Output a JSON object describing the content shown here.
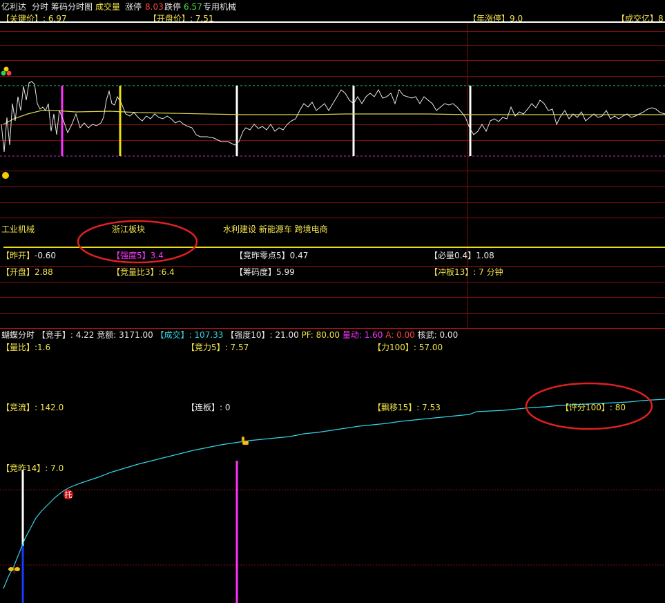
{
  "header": {
    "stock_name": "亿利达",
    "tab_intraday": "分时",
    "tab_chip": "筹码分时图",
    "volume_label": "成交量",
    "limit_up_label": "涨停",
    "limit_up_value": "8.03",
    "limit_down_label": "跌停",
    "limit_down_value": "6.57",
    "sector": "专用机械"
  },
  "price_bar": {
    "key_price": "【关键价】: 6.97",
    "open_price": "【开盘价】: 7.51",
    "year_limit_up": "【年涨停】9.0",
    "turnover": "【成交亿】8"
  },
  "concepts": {
    "industry": "工业机械",
    "board": "浙江板块",
    "themes": "水利建设 新能源车 跨境电商"
  },
  "stats_row1": {
    "prev_open": {
      "label": "【昨开】",
      "value": "-0.60"
    },
    "strength": {
      "label": "【强度5】",
      "value": "3.4"
    },
    "bid_zero": {
      "label": "【竞昨零点5】",
      "value": "0.47"
    },
    "must_volume": {
      "label": "【必量0.4】",
      "value": "1.08"
    }
  },
  "stats_row2": {
    "open_rise": {
      "label": "【开盘】",
      "value": "2.88"
    },
    "bid_ratio": {
      "label": "【竞量比3】",
      "value": ":6.4"
    },
    "chip_degree": {
      "label": "【筹码度】",
      "value": "5.99"
    },
    "board_hit": {
      "label": "【冲板13】",
      "value": ": 7 分钟"
    }
  },
  "indicator_bar": {
    "title": "蝴蝶分时",
    "bid_hand": "【竞手】: 4.22",
    "bid_amount": "竞额: 3171.00",
    "deal": "【成交】: 107.33",
    "strength10": "【强度10】: 21.00",
    "pf": "PF: 80.00",
    "volume_move": "量动: 1.60",
    "a_value": "A: 0.00",
    "core_force": "核武: 0.00"
  },
  "lower_labels": {
    "volume_ratio": "【量比】:1.6",
    "bid_force": "【竞力5】: 7.57",
    "force100": "【力100】: 57.00",
    "bid_flow": "【竞流】: 142.0",
    "consecutive": "【连板】: 0",
    "drift": "【飘移15】: 7.53",
    "score": "【评分100】: 80",
    "bid_yesterday": "【竞昨14】: 7.0",
    "marker_char": "托"
  },
  "colors": {
    "background": "#000000",
    "grid_red": "#8a0d0d",
    "price_line": "#e8e8e8",
    "avg_line": "#d8d84a",
    "cyan_line": "#33d6e8",
    "annotation_circle": "#e02020"
  }
}
